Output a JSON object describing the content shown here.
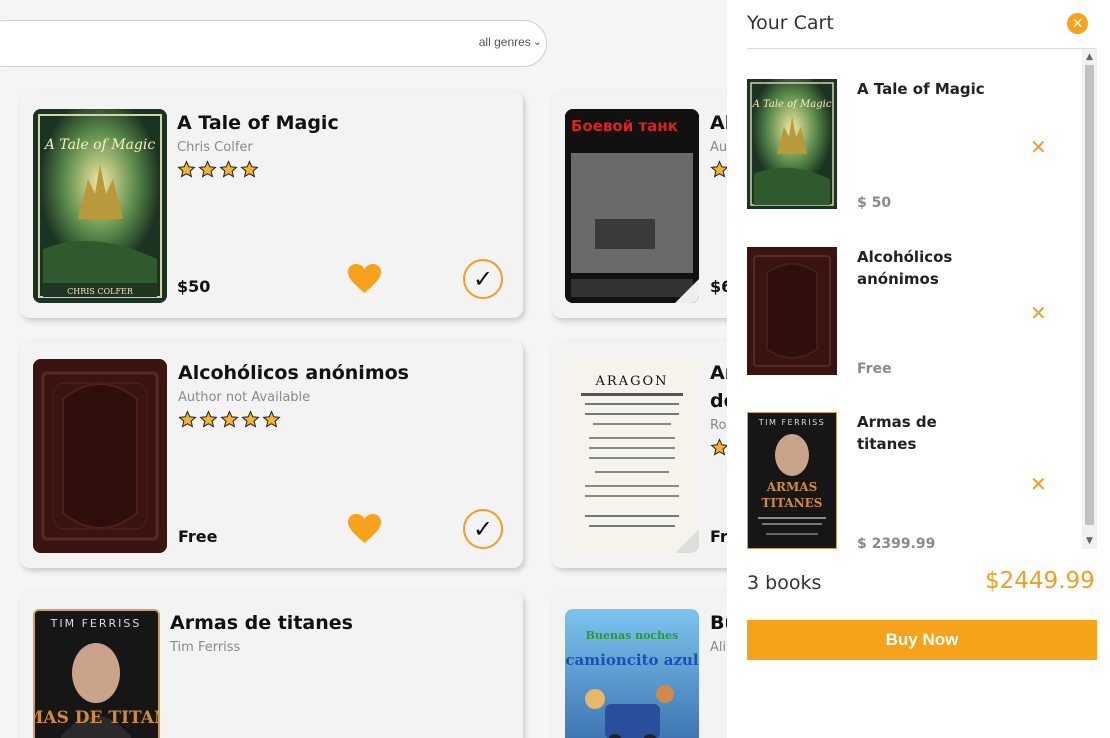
{
  "search": {
    "genre_selected": "all genres"
  },
  "colors": {
    "accent": "#f7a21b",
    "card_bg": "#f3f3f3",
    "muted_text": "#8a8a8a"
  },
  "books": [
    {
      "title": "A Tale of Magic",
      "author": "Chris Colfer",
      "rating": 4,
      "price": "$50",
      "favorited": true,
      "in_cart": true,
      "cover_text": "CHRIS COLFER"
    },
    {
      "title": "Alcohólicos anónimos",
      "author": "Author not Available",
      "rating": 5,
      "price": "Free",
      "favorited": true,
      "in_cart": true
    },
    {
      "title": "Armas de titanes",
      "author": "Tim Ferriss",
      "cover_top": "TIM FERRISS",
      "cover_title": "ARMAS DE TITANES"
    }
  ],
  "books_right": [
    {
      "title_fragment": "Al",
      "author_fragment": "Au",
      "price_fragment": "$6",
      "cover_text": "Боевой танк"
    },
    {
      "title_fragment": "Ar",
      "title_fragment_2": "de",
      "author_fragment": "Ro",
      "price_fragment": "Fr",
      "cover_text": "ARAGON"
    },
    {
      "title_fragment": "Bu",
      "author_fragment": "Ali",
      "cover_text": "Buenas noches camioncito azul"
    }
  ],
  "cart": {
    "title": "Your Cart",
    "close_icon": "close-circle",
    "items": [
      {
        "title": "A Tale of Magic",
        "price": "$ 50"
      },
      {
        "title": "Alcohólicos anónimos",
        "price": "Free"
      },
      {
        "title": "Armas de titanes",
        "price": "$ 2399.99"
      }
    ],
    "remove_icon": "✕",
    "count_label": "3 books",
    "total": "$2449.99",
    "buy_label": "Buy Now"
  }
}
